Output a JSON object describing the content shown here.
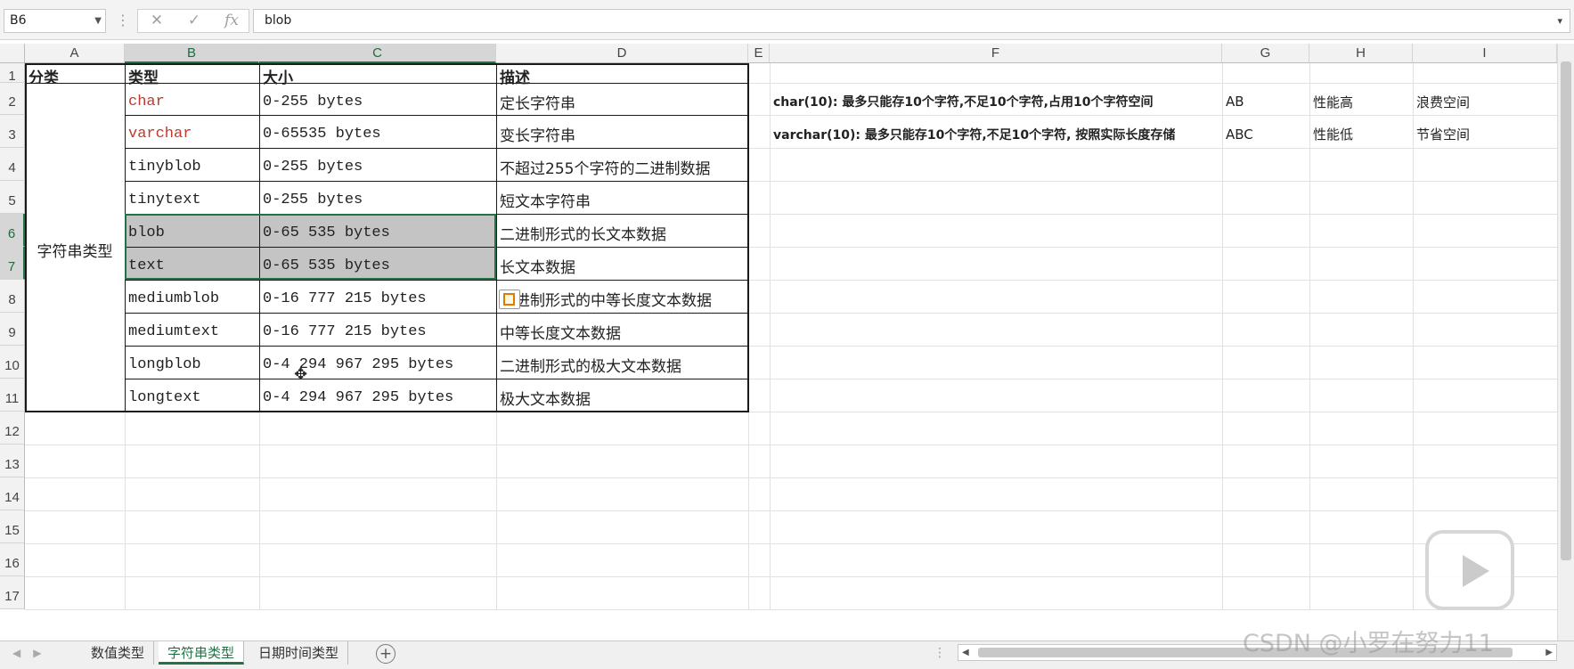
{
  "formula_bar": {
    "name_box": "B6",
    "formula": "blob",
    "cancel_icon": "close-icon",
    "enter_icon": "check-icon",
    "fx_label": "fx"
  },
  "columns": [
    "A",
    "B",
    "C",
    "D",
    "E",
    "F",
    "G",
    "H",
    "I"
  ],
  "rows": [
    "1",
    "2",
    "3",
    "4",
    "5",
    "6",
    "7",
    "8",
    "9",
    "10",
    "11",
    "12",
    "13",
    "14",
    "15",
    "16",
    "17"
  ],
  "table": {
    "headers": {
      "category": "分类",
      "type": "类型",
      "size": "大小",
      "desc": "描述"
    },
    "category_value": "字符串类型",
    "rows": [
      {
        "type": "char",
        "size": "0-255 bytes",
        "desc": "定长字符串"
      },
      {
        "type": "varchar",
        "size": "0-65535 bytes",
        "desc": "变长字符串"
      },
      {
        "type": "tinyblob",
        "size": "0-255 bytes",
        "desc": "不超过255个字符的二进制数据"
      },
      {
        "type": "tinytext",
        "size": "0-255 bytes",
        "desc": "短文本字符串"
      },
      {
        "type": "blob",
        "size": "0-65 535 bytes",
        "desc": "二进制形式的长文本数据"
      },
      {
        "type": "text",
        "size": "0-65 535 bytes",
        "desc": "长文本数据"
      },
      {
        "type": "mediumblob",
        "size": "0-16 777 215 bytes",
        "desc": "二进制形式的中等长度文本数据"
      },
      {
        "type": "mediumtext",
        "size": "0-16 777 215 bytes",
        "desc": "中等长度文本数据"
      },
      {
        "type": "longblob",
        "size": "0-4 294 967 295 bytes",
        "desc": "二进制形式的极大文本数据"
      },
      {
        "type": "longtext",
        "size": "0-4 294 967 295 bytes",
        "desc": "极大文本数据"
      }
    ]
  },
  "notes": [
    {
      "f": "char(10): 最多只能存10个字符,不足10个字符,占用10个字符空间",
      "g": "AB",
      "h": "性能高",
      "i": "浪费空间"
    },
    {
      "f": "varchar(10): 最多只能存10个字符,不足10个字符, 按照实际长度存储",
      "g": "ABC",
      "h": "性能低",
      "i": "节省空间"
    }
  ],
  "sheet_tabs": [
    "数值类型",
    "字符串类型",
    "日期时间类型"
  ],
  "active_tab": "字符串类型",
  "watermark": "CSDN @小罗在努力11",
  "colors": {
    "accent": "#217346",
    "red_text": "#c0392b",
    "selection_shade": "#c4c4c4"
  }
}
